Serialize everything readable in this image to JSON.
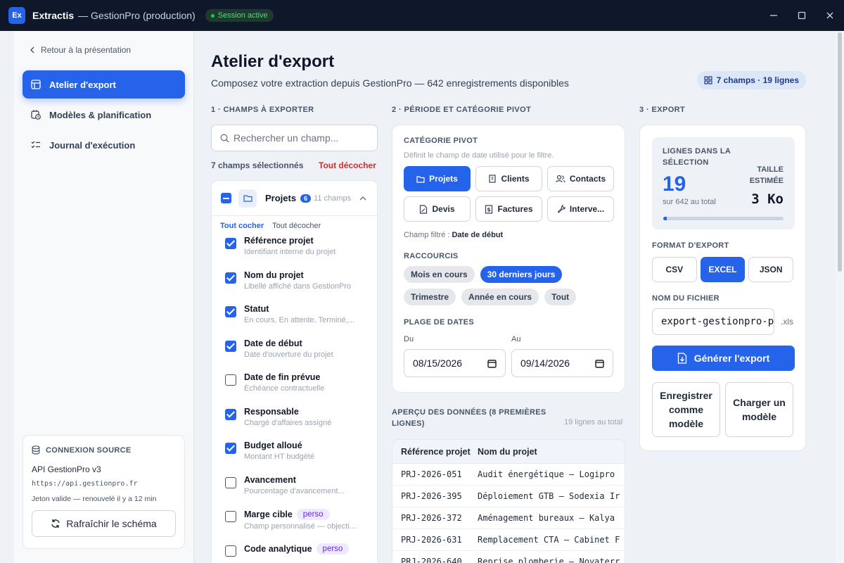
{
  "window": {
    "logo": "Ex",
    "app_name": "Extractis",
    "app_sub": "— GestionPro (production)",
    "session": "Session active"
  },
  "sidebar": {
    "back": "Retour à la présentation",
    "items": [
      {
        "label": "Atelier d'export",
        "icon": "table-icon",
        "active": true
      },
      {
        "label": "Modèles & planification",
        "icon": "calendar-clock-icon",
        "active": false
      },
      {
        "label": "Journal d'exécution",
        "icon": "checklist-icon",
        "active": false
      }
    ],
    "source": {
      "title": "CONNEXION SOURCE",
      "name": "API GestionPro v3",
      "url": "https://api.gestionpro.fr",
      "token": "Jeton valide — renouvelé il y a 12 min",
      "refresh": "Rafraîchir le schéma"
    }
  },
  "header": {
    "title": "Atelier d'export",
    "subtitle": "Composez votre extraction depuis GestionPro — 642 enregistrements disponibles",
    "summary": "7 champs · 19 lignes"
  },
  "fields": {
    "section": "1 · CHAMPS À EXPORTER",
    "search_placeholder": "Rechercher un champ...",
    "selected": "7 champs sélectionnés",
    "clear_all": "Tout décocher",
    "group": {
      "name": "Projets",
      "badge": "6",
      "count": "11 champs",
      "check_all": "Tout cocher",
      "uncheck_all": "Tout décocher"
    },
    "items": [
      {
        "name": "Référence projet",
        "desc": "Identifiant interne du projet",
        "checked": true,
        "tag": ""
      },
      {
        "name": "Nom du projet",
        "desc": "Libellé affiché dans GestionPro",
        "checked": true,
        "tag": ""
      },
      {
        "name": "Statut",
        "desc": "En cours, En attente, Terminé,...",
        "checked": true,
        "tag": ""
      },
      {
        "name": "Date de début",
        "desc": "Date d'ouverture du projet",
        "checked": true,
        "tag": ""
      },
      {
        "name": "Date de fin prévue",
        "desc": "Échéance contractuelle",
        "checked": false,
        "tag": ""
      },
      {
        "name": "Responsable",
        "desc": "Chargé d'affaires assigné",
        "checked": true,
        "tag": ""
      },
      {
        "name": "Budget alloué",
        "desc": "Montant HT budgété",
        "checked": true,
        "tag": ""
      },
      {
        "name": "Avancement",
        "desc": "Pourcentage d'avancement...",
        "checked": false,
        "tag": ""
      },
      {
        "name": "Marge cible",
        "desc": "Champ personnalisé — objecti...",
        "checked": false,
        "tag": "perso"
      },
      {
        "name": "Code analytique",
        "desc": "",
        "checked": false,
        "tag": "perso"
      }
    ]
  },
  "pivot": {
    "section": "2 · PÉRIODE ET CATÉGORIE PIVOT",
    "cat_title": "CATÉGORIE PIVOT",
    "cat_hint": "Définit le champ de date utilisé pour le filtre.",
    "categories": [
      {
        "label": "Projets",
        "icon": "folder-icon",
        "active": true
      },
      {
        "label": "Clients",
        "icon": "building-icon",
        "active": false
      },
      {
        "label": "Contacts",
        "icon": "users-icon",
        "active": false
      },
      {
        "label": "Devis",
        "icon": "file-edit-icon",
        "active": false
      },
      {
        "label": "Factures",
        "icon": "invoice-icon",
        "active": false
      },
      {
        "label": "Interve...",
        "icon": "wrench-icon",
        "active": false
      }
    ],
    "filter_label": "Champ filtré :",
    "filter_value": "Date de début",
    "shortcuts_title": "RACCOURCIS",
    "shortcuts": [
      {
        "label": "Mois en cours",
        "active": false
      },
      {
        "label": "30 derniers jours",
        "active": true
      },
      {
        "label": "Trimestre",
        "active": false
      },
      {
        "label": "Année en cours",
        "active": false
      },
      {
        "label": "Tout",
        "active": false
      }
    ],
    "range_title": "PLAGE DE DATES",
    "from_label": "Du",
    "to_label": "Au",
    "from": "08/15/2026",
    "to": "09/14/2026"
  },
  "preview": {
    "title": "APERÇU DES DONNÉES (8 PREMIÈRES LIGNES)",
    "count": "19 lignes au total",
    "columns": [
      "Référence projet",
      "Nom du projet"
    ],
    "rows": [
      [
        "PRJ-2026-051",
        "Audit énergétique — Logipro"
      ],
      [
        "PRJ-2026-395",
        "Déploiement GTB — Sodexia Ir"
      ],
      [
        "PRJ-2026-372",
        "Aménagement bureaux — Kalya"
      ],
      [
        "PRJ-2026-631",
        "Remplacement CTA — Cabinet F"
      ],
      [
        "PRJ-2026-640",
        "Reprise plomberie — Novaterr"
      ]
    ]
  },
  "export": {
    "section": "3 · EXPORT",
    "rows_label": "LIGNES DANS LA SÉLECTION",
    "rows_value": "19",
    "rows_sub": "sur 642 au total",
    "rows_fraction": 0.03,
    "size_label": "TAILLE ESTIMÉE",
    "size_value": "3 Ko",
    "format_label": "FORMAT D'EXPORT",
    "formats": [
      {
        "label": "CSV",
        "active": false
      },
      {
        "label": "EXCEL",
        "active": true
      },
      {
        "label": "JSON",
        "active": false
      }
    ],
    "file_label": "NOM DU FICHIER",
    "file_value": "export-gestionpro-projets",
    "file_ext": ".xls",
    "generate": "Générer l'export",
    "save_template": "Enregistrer comme modèle",
    "load_template": "Charger un modèle"
  }
}
